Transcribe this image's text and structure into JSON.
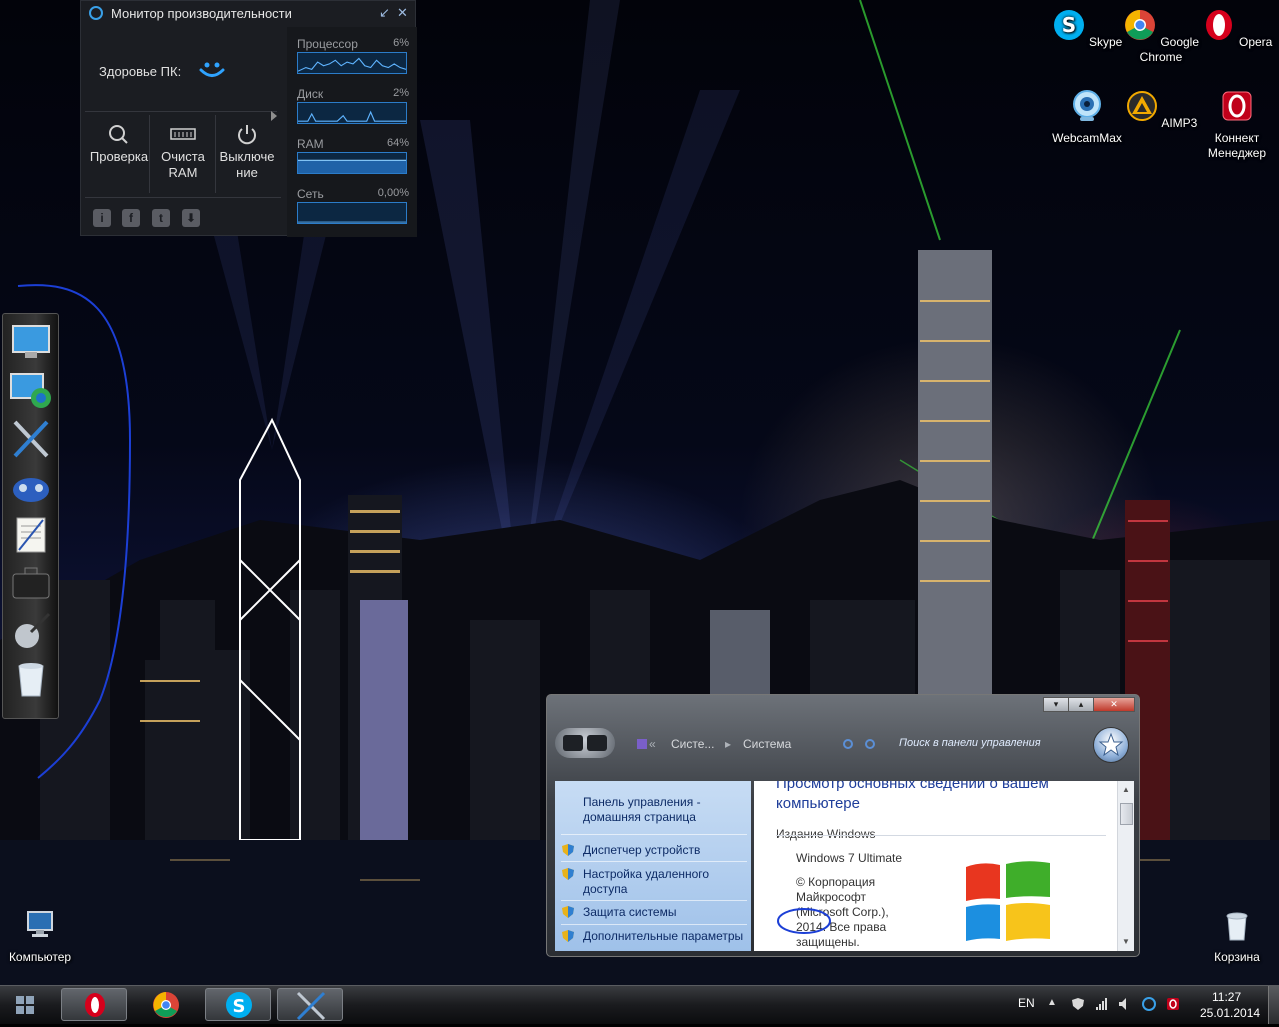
{
  "perf_monitor": {
    "title": "Монитор производительности",
    "health_label": "Здоровье ПК:",
    "tools": [
      {
        "label": "Проверка",
        "icon": "magnifier-icon"
      },
      {
        "label": "Очиста RAM",
        "icon": "ram-chip-icon"
      },
      {
        "label": "Выключение",
        "icon": "power-icon"
      }
    ],
    "social": [
      {
        "icon": "info-icon",
        "glyph": "i"
      },
      {
        "icon": "facebook-icon",
        "glyph": "f"
      },
      {
        "icon": "twitter-icon",
        "glyph": "t"
      },
      {
        "icon": "download-icon",
        "glyph": "⬇"
      }
    ],
    "meters": [
      {
        "name": "Процессор",
        "value": "6%"
      },
      {
        "name": "Диск",
        "value": "2%"
      },
      {
        "name": "RAM",
        "value": "64%"
      },
      {
        "name": "Сеть",
        "value": "0,00%"
      }
    ]
  },
  "desktop_icons": {
    "skype": "Skype",
    "chrome": "Google Chrome",
    "opera": "Opera",
    "webcammax": "WebcamMax",
    "aimp3": "AIMP3",
    "connect_manager": "Коннект Менеджер",
    "computer": "Компьютер",
    "recycle_bin": "Корзина"
  },
  "control_panel": {
    "breadcrumb_1": "Систе...",
    "breadcrumb_2": "Система",
    "search_placeholder": "Поиск в панели управления",
    "left_pane": {
      "home_link": "Панель управления - домашняя страница",
      "links": [
        "Диспетчер устройств",
        "Настройка удаленного доступа",
        "Защита системы",
        "Дополнительные параметры"
      ]
    },
    "heading": "Просмотр основных сведений о вашем компьютере",
    "section": "Издание Windows",
    "edition": "Windows 7 Ultimate",
    "copyright": "© Корпорация Майкрософт (Microsoft Corp.), 2014. Все права защищены."
  },
  "taskbar": {
    "language": "EN",
    "time": "11:27",
    "date": "25.01.2014"
  },
  "colors": {
    "accent_blue": "#2b7cc9",
    "opera_red": "#d6001c",
    "skype_blue": "#00aff0"
  }
}
